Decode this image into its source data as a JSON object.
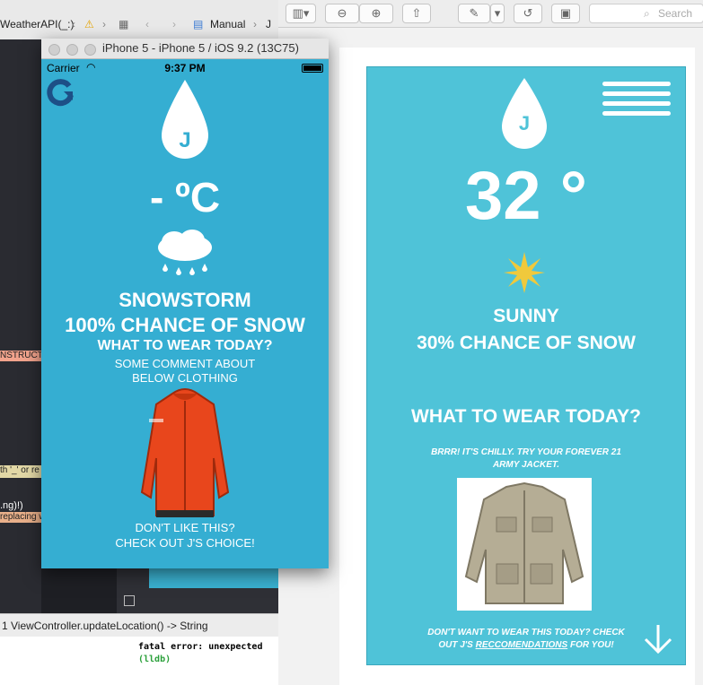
{
  "xcode": {
    "breadcrumb_func": "WeatherAPI(_:)",
    "breadcrumb_manual": "Manual",
    "breadcrumb_file": "J",
    "code_instruct": "NSTRUCT",
    "code_hint": "th '_' or re",
    "code_ng": ".ng)!)",
    "code_replacing": "replacing w",
    "debug_frame": "1 ViewController.updateLocation() -> String",
    "console_error": "fatal error: unexpected",
    "console_prompt": "(lldb)"
  },
  "preview": {
    "search_placeholder": "Search"
  },
  "simulator": {
    "title": "iPhone 5 - iPhone 5 / iOS 9.2 (13C75)",
    "carrier": "Carrier",
    "time": "9:37 PM",
    "logo_letter": "J",
    "temperature": "- ºC",
    "condition": "SNOWSTORM",
    "chance": "100% CHANCE OF SNOW",
    "question": "WHAT TO WEAR TODAY?",
    "comment_line1": "SOME COMMENT ABOUT",
    "comment_line2": "BELOW CLOTHING",
    "dislike_line1": "DON'T LIKE THIS?",
    "dislike_line2": "CHECK OUT J'S CHOICE!"
  },
  "mockup": {
    "logo_letter": "J",
    "temperature": "32 °",
    "condition": "SUNNY",
    "chance": "30% CHANCE OF SNOW",
    "question": "WHAT TO WEAR TODAY?",
    "tip_line1": "BRRR! IT'S CHILLY. TRY YOUR FOREVER 21",
    "tip_line2": "ARMY JACKET.",
    "footer_line1": "DON'T WANT TO WEAR THIS TODAY? CHECK",
    "footer_line2_pre": "OUT J'S ",
    "footer_link": "RECCOMENDATIONS",
    "footer_line2_post": " FOR YOU!"
  },
  "colors": {
    "sim_bg": "#35aed2",
    "mockup_bg": "#4fc3d8",
    "jacket_orange": "#e8461c",
    "jacket_khaki": "#b5ad95",
    "sun": "#f0c93c"
  }
}
